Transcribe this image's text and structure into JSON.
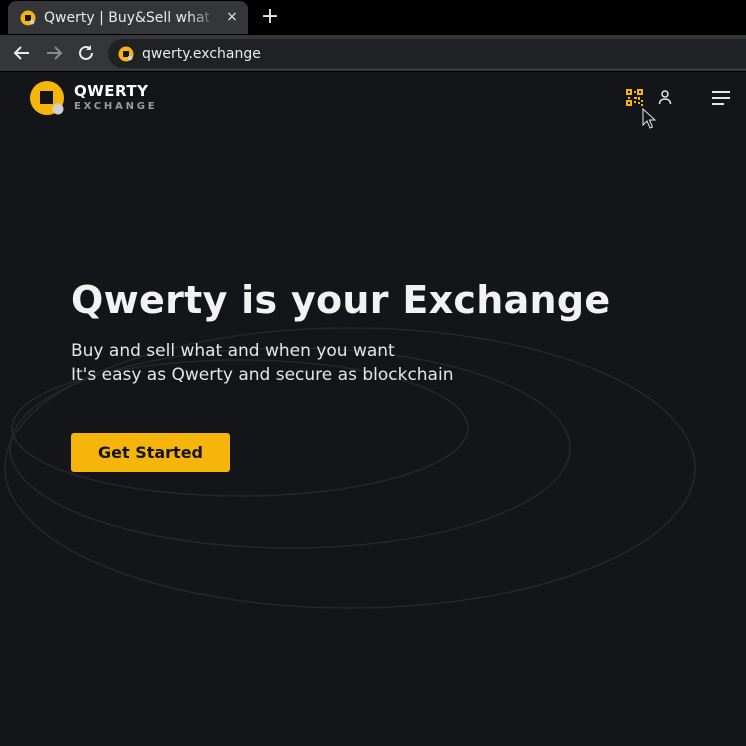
{
  "browser": {
    "tab_title": "Qwerty | Buy&Sell what and when you want",
    "tab_close": "×",
    "new_tab": "+",
    "url": "qwerty.exchange"
  },
  "header": {
    "logo_line1": "QWERTY",
    "logo_line2": "EXCHANGE",
    "icons": [
      "qr-code-icon",
      "user-icon",
      "hamburger-menu-icon"
    ]
  },
  "hero": {
    "title": "Qwerty is your Exchange",
    "subtitle_line1": "Buy and sell what and when you want",
    "subtitle_line2": "It's easy as Qwerty and secure as blockchain",
    "cta_label": "Get Started"
  },
  "colors": {
    "accent": "#f5b50a",
    "background": "#141518",
    "chrome_tab": "#35363a"
  }
}
